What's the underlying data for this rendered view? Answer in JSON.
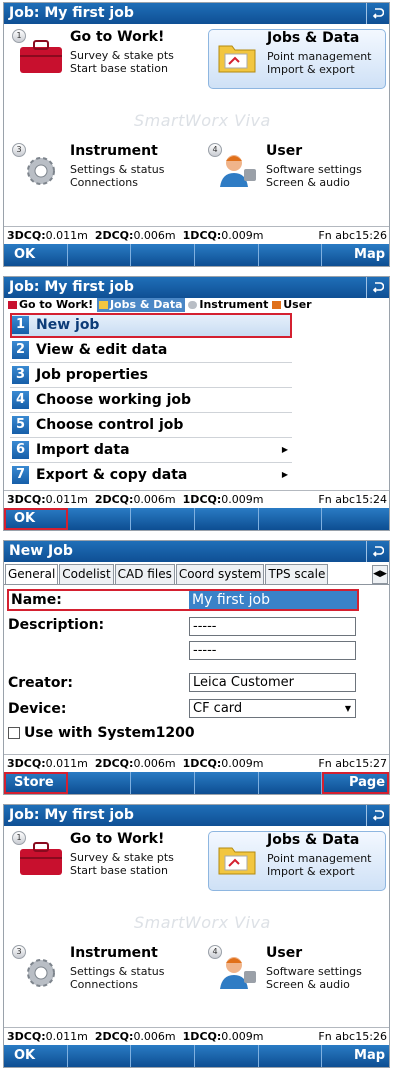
{
  "screen1": {
    "title": "Job: My first job",
    "watermark": "SmartWorx Viva",
    "tiles": [
      {
        "num": "1",
        "name": "Go to Work!",
        "l1": "Survey & stake pts",
        "l2": "Start base station"
      },
      {
        "num": "2",
        "name": "Jobs & Data",
        "l1": "Point management",
        "l2": "Import & export"
      },
      {
        "num": "3",
        "name": "Instrument",
        "l1": "Settings & status",
        "l2": "Connections"
      },
      {
        "num": "4",
        "name": "User",
        "l1": "Software settings",
        "l2": "Screen & audio"
      }
    ],
    "status": {
      "q3_label": "3DCQ:",
      "q3": "0.011m",
      "q2_label": "2DCQ:",
      "q2": "0.006m",
      "q1_label": "1DCQ:",
      "q1": "0.009m",
      "fn": "Fn  abc",
      "time": "15:26"
    },
    "softkeys": [
      "OK",
      "",
      "",
      "",
      "",
      "Map"
    ]
  },
  "screen2": {
    "title": "Job: My first job",
    "breadcrumb_tabs": [
      "Go to Work!",
      "Jobs & Data",
      "Instrument",
      "User"
    ],
    "menu": [
      {
        "n": "1",
        "label": "New job",
        "submenu": false
      },
      {
        "n": "2",
        "label": "View & edit data",
        "submenu": false
      },
      {
        "n": "3",
        "label": "Job properties",
        "submenu": false
      },
      {
        "n": "4",
        "label": "Choose working job",
        "submenu": false
      },
      {
        "n": "5",
        "label": "Choose control job",
        "submenu": false
      },
      {
        "n": "6",
        "label": "Import data",
        "submenu": true
      },
      {
        "n": "7",
        "label": "Export & copy data",
        "submenu": true
      }
    ],
    "status": {
      "q3_label": "3DCQ:",
      "q3": "0.011m",
      "q2_label": "2DCQ:",
      "q2": "0.006m",
      "q1_label": "1DCQ:",
      "q1": "0.009m",
      "fn": "Fn  abc",
      "time": "15:24"
    },
    "softkeys": [
      "OK",
      "",
      "",
      "",
      "",
      ""
    ]
  },
  "screen3": {
    "title": "New Job",
    "tabs": [
      "General",
      "Codelist",
      "CAD files",
      "Coord system",
      "TPS scale"
    ],
    "fields": {
      "name_label": "Name:",
      "name_value": "My first job",
      "desc_label": "Description:",
      "desc1": "-----",
      "desc2": "-----",
      "creator_label": "Creator:",
      "creator_value": "Leica Customer",
      "device_label": "Device:",
      "device_value": "CF card",
      "checkbox_label": "Use with System1200"
    },
    "status": {
      "q3_label": "3DCQ:",
      "q3": "0.011m",
      "q2_label": "2DCQ:",
      "q2": "0.006m",
      "q1_label": "1DCQ:",
      "q1": "0.009m",
      "fn": "Fn  abc",
      "time": "15:27"
    },
    "softkeys": [
      "Store",
      "",
      "",
      "",
      "",
      "Page"
    ]
  },
  "screen4": {
    "title": "Job: My first job",
    "watermark": "SmartWorx Viva",
    "tiles": [
      {
        "num": "1",
        "name": "Go to Work!",
        "l1": "Survey & stake pts",
        "l2": "Start base station"
      },
      {
        "num": "2",
        "name": "Jobs & Data",
        "l1": "Point management",
        "l2": "Import & export"
      },
      {
        "num": "3",
        "name": "Instrument",
        "l1": "Settings & status",
        "l2": "Connections"
      },
      {
        "num": "4",
        "name": "User",
        "l1": "Software settings",
        "l2": "Screen & audio"
      }
    ],
    "status": {
      "q3_label": "3DCQ:",
      "q3": "0.011m",
      "q2_label": "2DCQ:",
      "q2": "0.006m",
      "q1_label": "1DCQ:",
      "q1": "0.009m",
      "fn": "Fn  abc",
      "time": "15:26"
    },
    "softkeys": [
      "OK",
      "",
      "",
      "",
      "",
      "Map"
    ]
  },
  "icons": {
    "back": "back-arrow-icon",
    "toolbox": "red-toolbox-icon",
    "folder": "folder-icon",
    "gear": "gear-icon",
    "user": "user-icon"
  },
  "colors": {
    "titlebar": "#1565b0",
    "highlight": "#d42030",
    "badge": "#1f6fba"
  }
}
